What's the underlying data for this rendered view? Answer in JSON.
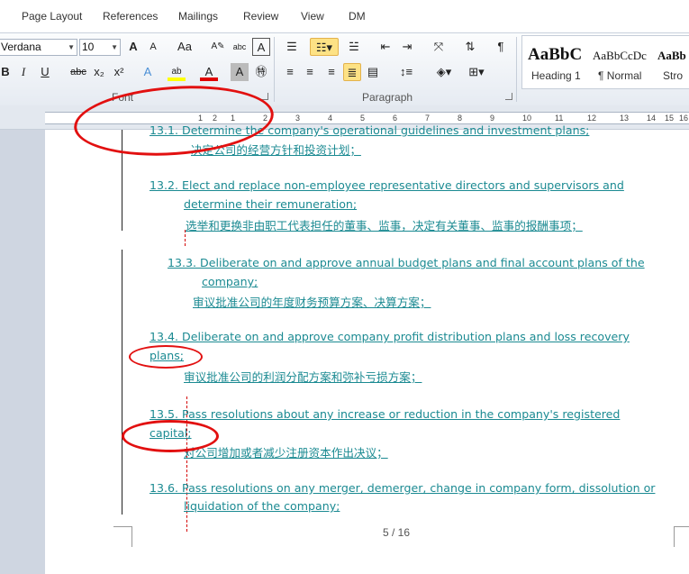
{
  "tabs": [
    "Page Layout",
    "References",
    "Mailings",
    "Review",
    "View",
    "DM"
  ],
  "font": {
    "name": "Verdana",
    "size": "10",
    "group_label": "Font",
    "buttons": {
      "grow": "A",
      "shrink": "A",
      "case": "Aa",
      "bold": "B",
      "italic": "I",
      "underline": "U",
      "strike": "abc",
      "subscript": "x₂",
      "superscript": "x²",
      "highlight": "ab",
      "color": "A"
    }
  },
  "paragraph": {
    "group_label": "Paragraph",
    "pilcrow": "¶"
  },
  "styles": [
    {
      "sample": "AaBbC",
      "name": "Heading 1"
    },
    {
      "sample": "AaBbCcDc",
      "name": "¶ Normal"
    },
    {
      "sample": "AaBb",
      "name": "Stro"
    }
  ],
  "ruler": {
    "labels": [
      "1",
      "2",
      "1",
      "2",
      "3",
      "4",
      "5",
      "6",
      "7",
      "8",
      "9",
      "10",
      "11",
      "12",
      "13",
      "14",
      "15",
      "16"
    ]
  },
  "document": {
    "lines": {
      "l1": "13.1.     Determine the company's operational guidelines and investment plans;",
      "l1cn": "决定公司的经营方针和投资计划；",
      "l2a": "13.2.  Elect and replace non-employee representative directors and supervisors and",
      "l2b": "determine their    remuneration;",
      "l2cn": "选举和更换非由职工代表担任的董事、监事，决定有关董事、监事的报酬事项；",
      "l3a": "13.3. Deliberate on and approve annual budget plans and final account plans of the",
      "l3b": "company;",
      "l3cn": "审议批准公司的年度财务预算方案、决算方案；",
      "l4a": "13.4.      Deliberate on and approve company profit distribution plans and loss recovery",
      "l4b": "plans;",
      "l4cn": "审议批准公司的利润分配方案和弥补亏损方案；",
      "l5a": "13.5.      Pass resolutions  about  any increase or reduction  in the company's registered",
      "l5b": "capital;",
      "l5cn": "对公司增加或者减少注册资本作出决议；",
      "l6a": "13.6. Pass resolutions on any merger, demerger, change in company form, dissolution or",
      "l6b": "liquidation  of the company;"
    },
    "page_number": "5 / 16"
  },
  "colors": {
    "tracked_text": "#1b8a92",
    "annotation": "#e21010",
    "change_bar": "#222222"
  }
}
